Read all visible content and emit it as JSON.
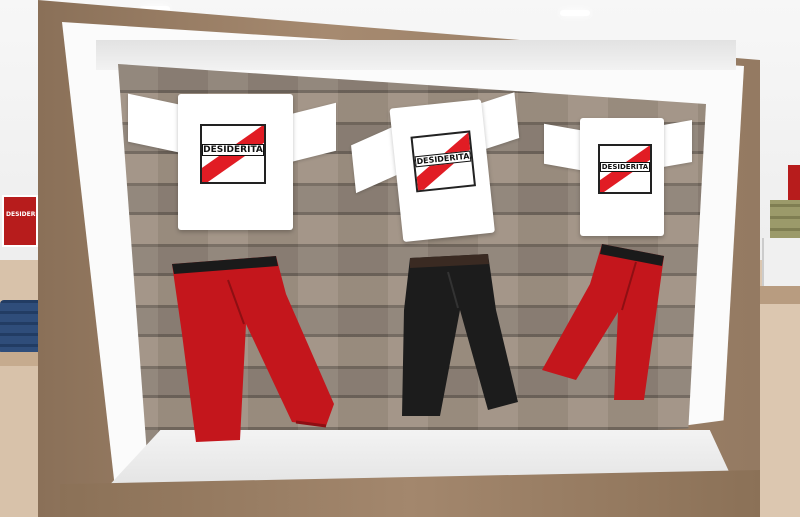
{
  "scene": {
    "title": "",
    "colors": {
      "shirt": "#ffffff",
      "logo_stripe": "#e11c24",
      "red_pants": "#c4161c",
      "black_pants": "#1c1c1c",
      "wood": "#8f8378",
      "frame": "#fbfbfb"
    }
  },
  "display": {
    "brand": "DESIDERITA",
    "shirts": [
      {
        "label": "DESIDERITA",
        "color": "white"
      },
      {
        "label": "DESIDERITA",
        "color": "white"
      },
      {
        "label": "DESIDERITA",
        "color": "white"
      }
    ],
    "pants": [
      {
        "color": "red"
      },
      {
        "color": "black"
      },
      {
        "color": "red"
      }
    ]
  },
  "background": {
    "left_poster_label": "DESIDERITA"
  }
}
